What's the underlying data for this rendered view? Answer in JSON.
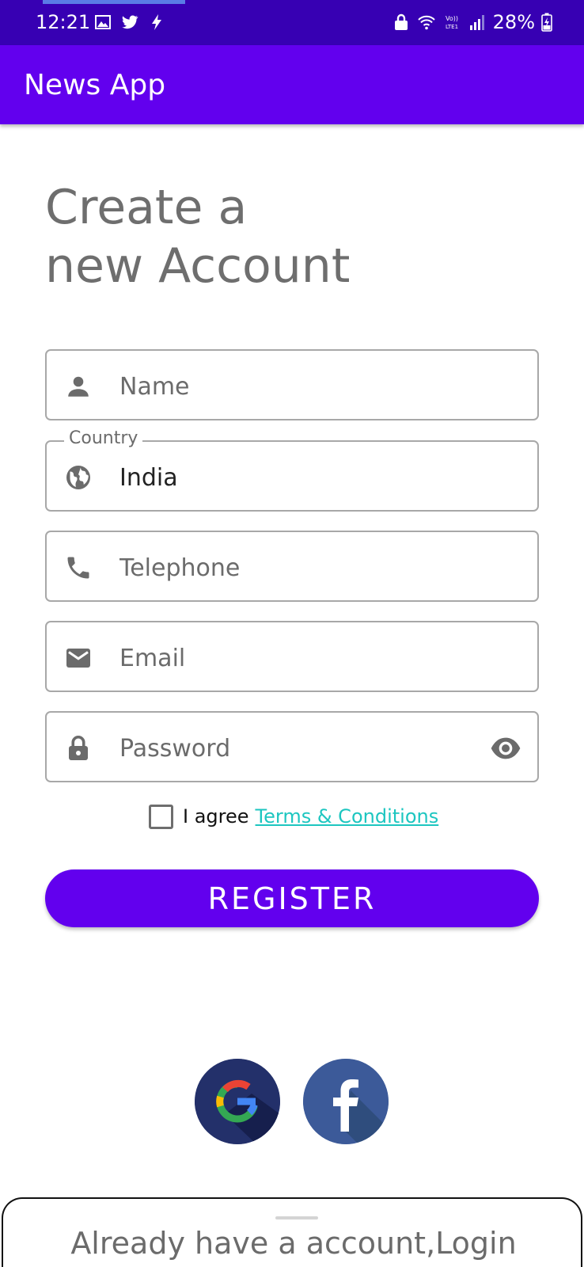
{
  "status_bar": {
    "time": "12:21",
    "battery": "28%",
    "icons": [
      "image-icon",
      "twitter-icon",
      "charging-bolt-icon",
      "lock-icon",
      "wifi-icon",
      "volte-icon",
      "signal-icon",
      "battery-icon"
    ]
  },
  "app_bar": {
    "title": "News App"
  },
  "heading": "Create a\nnew Account",
  "form": {
    "name": {
      "placeholder": "Name",
      "value": ""
    },
    "country": {
      "label": "Country",
      "value": "India"
    },
    "telephone": {
      "placeholder": "Telephone",
      "value": ""
    },
    "email": {
      "placeholder": "Email",
      "value": ""
    },
    "password": {
      "placeholder": "Password",
      "value": ""
    }
  },
  "agree": {
    "checked": false,
    "text": "I agree",
    "link": "Terms & Conditions"
  },
  "register": {
    "label": "REGISTER"
  },
  "social": [
    "google-icon",
    "facebook-icon"
  ],
  "bottom_sheet": {
    "login_text": "Already have a account,Login"
  },
  "colors": {
    "primary": "#6200ee",
    "status_bar": "#3700b3",
    "link": "#1dc6c0",
    "heading": "#6e6e6e"
  }
}
